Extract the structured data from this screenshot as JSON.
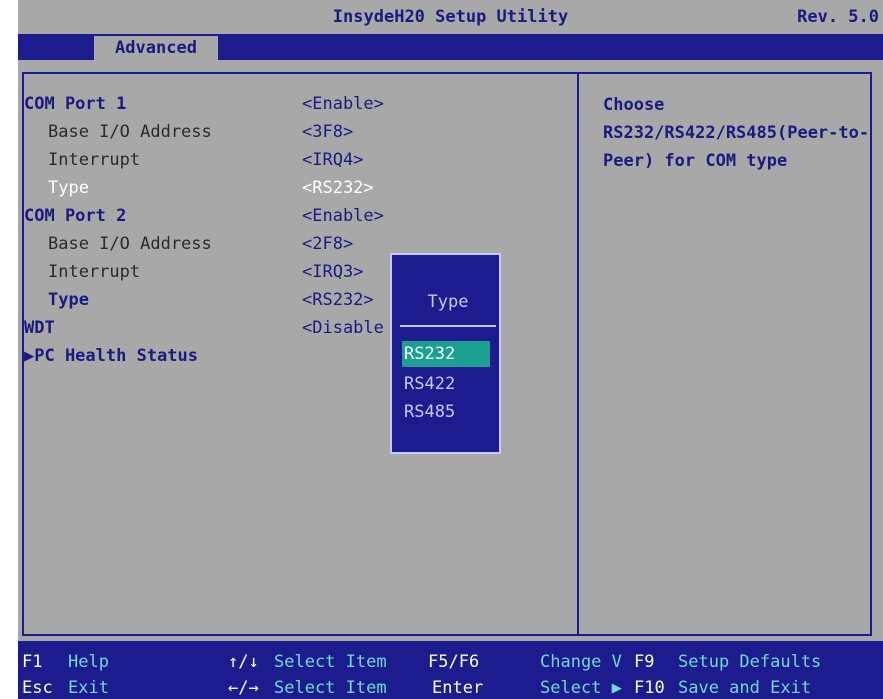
{
  "header": {
    "title": "InsydeH20 Setup Utility",
    "revision": "Rev. 5.0"
  },
  "tabs": {
    "active": "Advanced"
  },
  "settings": [
    {
      "label": "COM Port 1",
      "value": "<Enable>"
    },
    {
      "label": "Base I/O Address",
      "value": "<3F8>"
    },
    {
      "label": "Interrupt",
      "value": "<IRQ4>"
    },
    {
      "label": "Type",
      "value": "<RS232>"
    },
    {
      "label": "COM Port 2",
      "value": "<Enable>"
    },
    {
      "label": "Base I/O Address",
      "value": "<2F8>"
    },
    {
      "label": "Interrupt",
      "value": "<IRQ3>"
    },
    {
      "label": "Type",
      "value": "<RS232>"
    },
    {
      "label": "WDT",
      "value": "<Disable"
    },
    {
      "label": "▶PC Health Status",
      "value": ""
    }
  ],
  "help": {
    "lines": [
      "Choose",
      "RS232/RS422/RS485(Peer-to-",
      "Peer) for COM type"
    ]
  },
  "popup": {
    "title": "Type",
    "options": [
      "RS232",
      "RS422",
      "RS485"
    ],
    "selected": "RS232"
  },
  "footer": {
    "row1": {
      "f1_key": "F1",
      "f1_desc": "Help",
      "arrows_key": "↑/↓",
      "arrows_desc": "Select Item",
      "f5f6_key": "F5/F6",
      "change_desc": "Change V",
      "f9_key": "F9",
      "f9_desc": "Setup Defaults"
    },
    "row2": {
      "esc_key": "Esc",
      "esc_desc": "Exit",
      "lr_key": "←/→",
      "lr_desc": "Select Item",
      "enter_key": "Enter",
      "select_desc": "Select ▶",
      "f10_key": "F10",
      "f10_desc": "Save and Exit"
    }
  },
  "colors": {
    "bios_gray": "#a8a8a8",
    "bios_blue": "#1c1c8e",
    "highlight_teal": "#19a090",
    "footer_desc_cyan": "#6cdbd0"
  }
}
